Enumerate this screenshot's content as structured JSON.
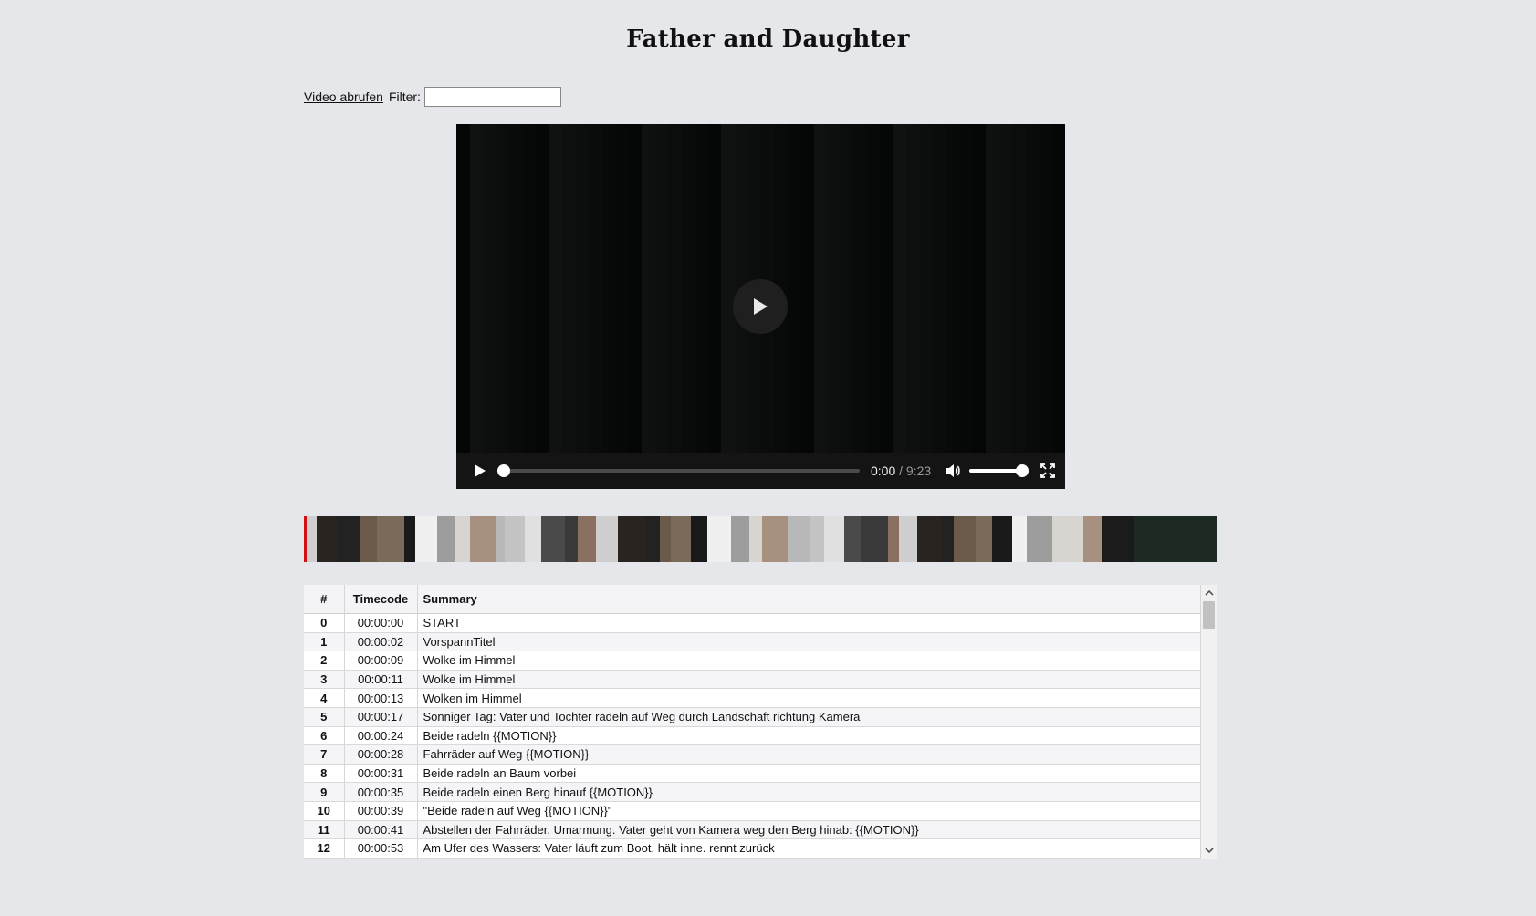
{
  "page": {
    "title": "Father and Daughter"
  },
  "toolbar": {
    "video_link": "Video abrufen",
    "filter_label": "Filter:",
    "filter_value": "",
    "filter_placeholder": ""
  },
  "video": {
    "current_time": "0:00",
    "duration": " / 9:23",
    "progress": 0.0,
    "volume": 1.0,
    "icons": {
      "big_play": "play-icon",
      "play": "play-icon",
      "volume": "volume-icon",
      "fullscreen": "fullscreen-icon"
    }
  },
  "filmstrip": {
    "marker_color": "#d01212"
  },
  "table": {
    "headers": {
      "num": "#",
      "timecode": "Timecode",
      "summary": "Summary"
    },
    "rows": [
      {
        "num": "0",
        "timecode": "00:00:00",
        "summary": "START"
      },
      {
        "num": "1",
        "timecode": "00:00:02",
        "summary": "VorspannTitel"
      },
      {
        "num": "2",
        "timecode": "00:00:09",
        "summary": "Wolke im Himmel"
      },
      {
        "num": "3",
        "timecode": "00:00:11",
        "summary": "Wolke im Himmel"
      },
      {
        "num": "4",
        "timecode": "00:00:13",
        "summary": "Wolken im Himmel"
      },
      {
        "num": "5",
        "timecode": "00:00:17",
        "summary": "Sonniger Tag: Vater und Tochter radeln auf Weg durch Landschaft richtung Kamera"
      },
      {
        "num": "6",
        "timecode": "00:00:24",
        "summary": "Beide radeln {{MOTION}}"
      },
      {
        "num": "7",
        "timecode": "00:00:28",
        "summary": "Fahrräder auf Weg {{MOTION}}"
      },
      {
        "num": "8",
        "timecode": "00:00:31",
        "summary": "Beide radeln an Baum vorbei"
      },
      {
        "num": "9",
        "timecode": "00:00:35",
        "summary": "Beide radeln einen Berg hinauf {{MOTION}}"
      },
      {
        "num": "10",
        "timecode": "00:00:39",
        "summary": "\"Beide radeln auf Weg {{MOTION}}\""
      },
      {
        "num": "11",
        "timecode": "00:00:41",
        "summary": "Abstellen der Fahrräder. Umarmung. Vater geht von Kamera weg den Berg hinab: {{MOTION}}"
      },
      {
        "num": "12",
        "timecode": "00:00:53",
        "summary": "Am Ufer des Wassers: Vater läuft zum Boot. hält inne. rennt zurück"
      }
    ]
  }
}
